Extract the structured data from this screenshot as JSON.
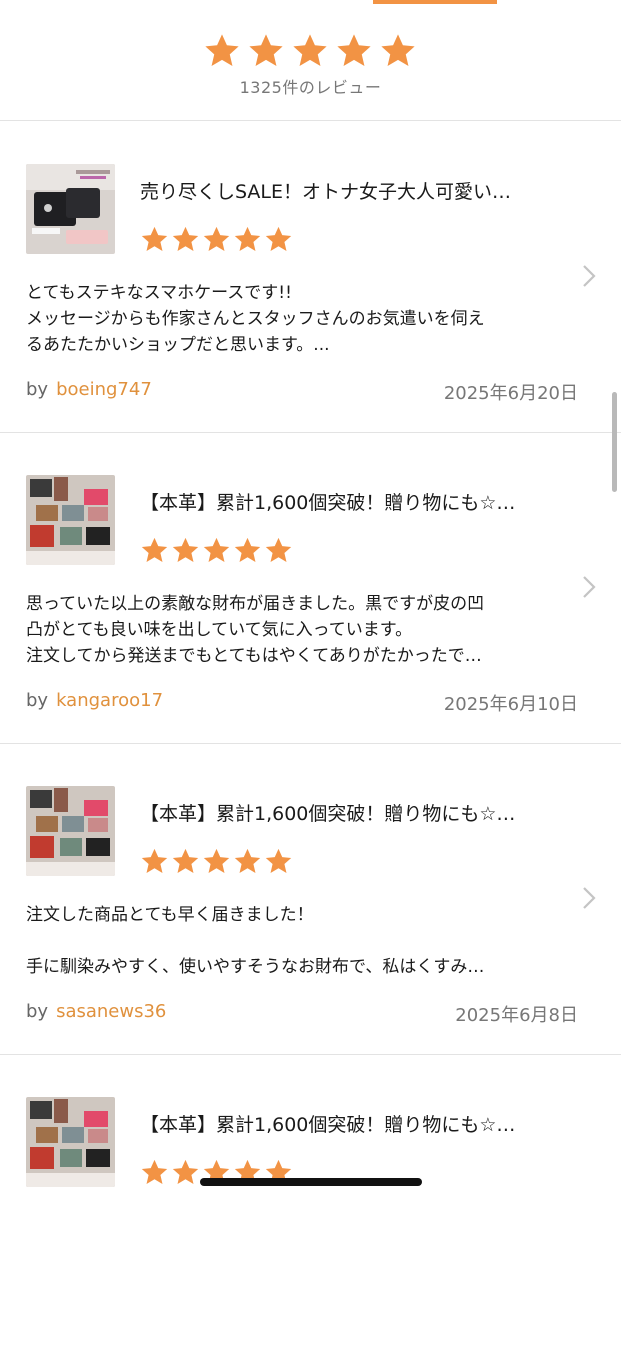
{
  "accent_color": "#f29344",
  "summary": {
    "rating": 5,
    "count_text": "1325件のレビュー"
  },
  "reviews": [
    {
      "product_title": "売り尽くしSALE！オトナ女子大人可愛い…",
      "rating": 5,
      "body_lines": [
        "とてもステキなスマホケースです!!",
        "メッセージからも作家さんとスタッフさんのお気遣いを伺え",
        "るあたたかいショップだと思います。..."
      ],
      "by_label": "by",
      "username": "boeing747",
      "date": "2025年6月20日"
    },
    {
      "product_title": "【本革】累計1,600個突破！贈り物にも☆…",
      "rating": 5,
      "body_lines": [
        "思っていた以上の素敵な財布が届きました。黒ですが皮の凹",
        "凸がとても良い味を出していて気に入っています。",
        "注文してから発送までもとてもはやくてありがたかったで…"
      ],
      "by_label": "by",
      "username": "kangaroo17",
      "date": "2025年6月10日"
    },
    {
      "product_title": "【本革】累計1,600個突破！贈り物にも☆…",
      "rating": 5,
      "body_lines": [
        "注文した商品とても早く届きました！",
        "",
        "手に馴染みやすく、使いやすそうなお財布で、私はくすみ…"
      ],
      "by_label": "by",
      "username": "sasanews36",
      "date": "2025年6月8日"
    },
    {
      "product_title": "【本革】累計1,600個突破！贈り物にも☆…",
      "rating": 5
    }
  ]
}
